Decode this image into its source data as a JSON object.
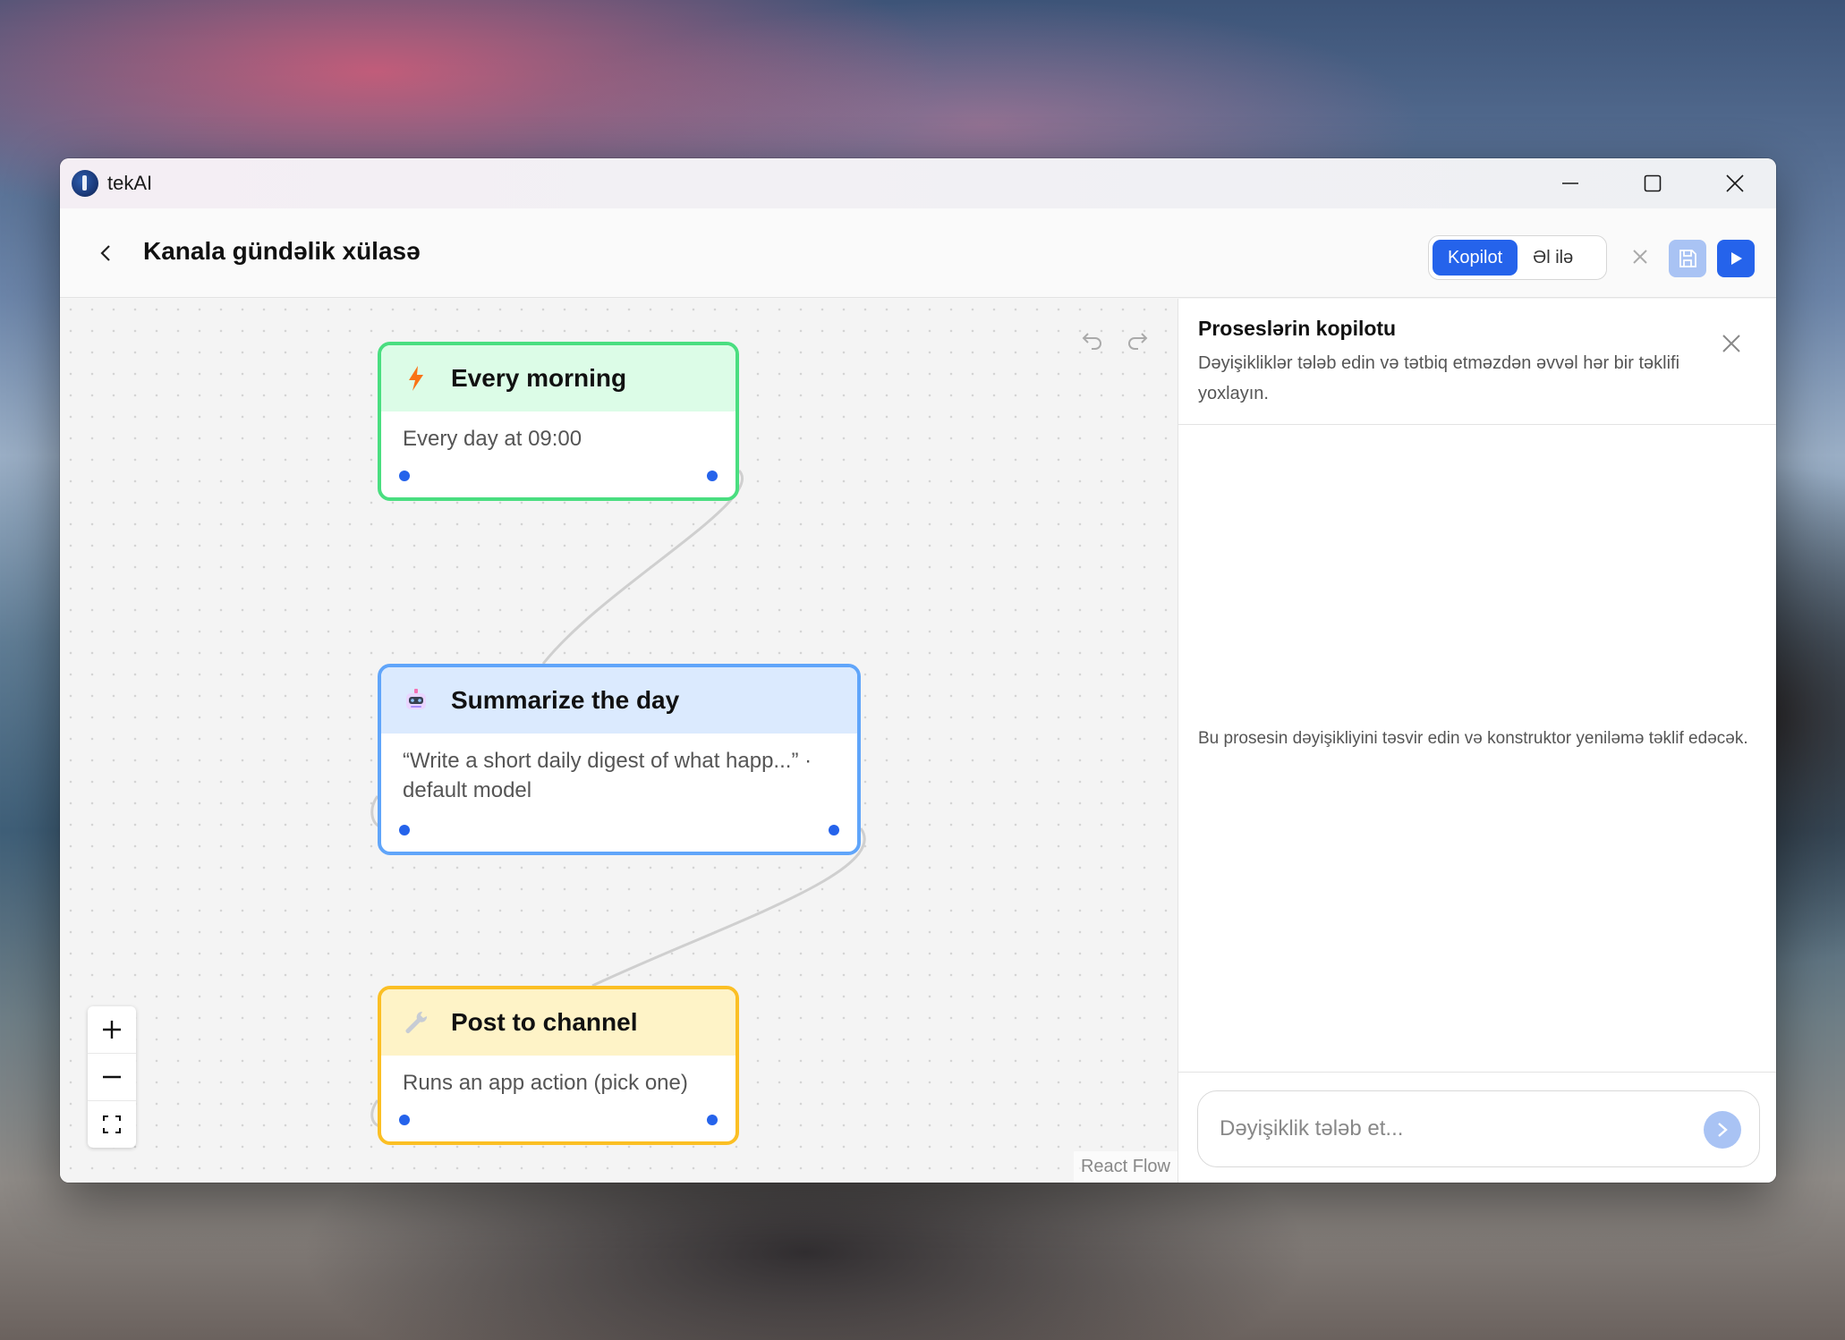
{
  "window": {
    "app_name": "tekAI"
  },
  "header": {
    "title": "Kanala gündəlik xülasə",
    "modes": [
      {
        "label": "Kopilot",
        "active": true
      },
      {
        "label": "Əl ilə",
        "active": false
      }
    ]
  },
  "canvas": {
    "nodes": [
      {
        "icon": "lightning-icon",
        "title": "Every morning",
        "body": "Every day at 09:00",
        "color": "#4ade80"
      },
      {
        "icon": "robot-icon",
        "title": "Summarize the day",
        "body": "“Write a short daily digest of what happ...” · default model",
        "color": "#60a5fa"
      },
      {
        "icon": "wrench-icon",
        "title": "Post to channel",
        "body": "Runs an app action (pick one)",
        "color": "#fbbf24"
      }
    ],
    "attribution": "React Flow"
  },
  "panel": {
    "title": "Proseslərin kopilotu",
    "subtitle": "Dəyişikliklər tələb edin və tətbiq etməzdən əvvəl hər bir təklifi yoxlayın.",
    "empty_state": "Bu prosesin dəyişikliyini təsvir edin və konstruktor yeniləmə təklif edəcək.",
    "input_placeholder": "Dəyişiklik tələb et..."
  },
  "colors": {
    "accent": "#2563eb",
    "accent_disabled": "#a9c3f4"
  }
}
